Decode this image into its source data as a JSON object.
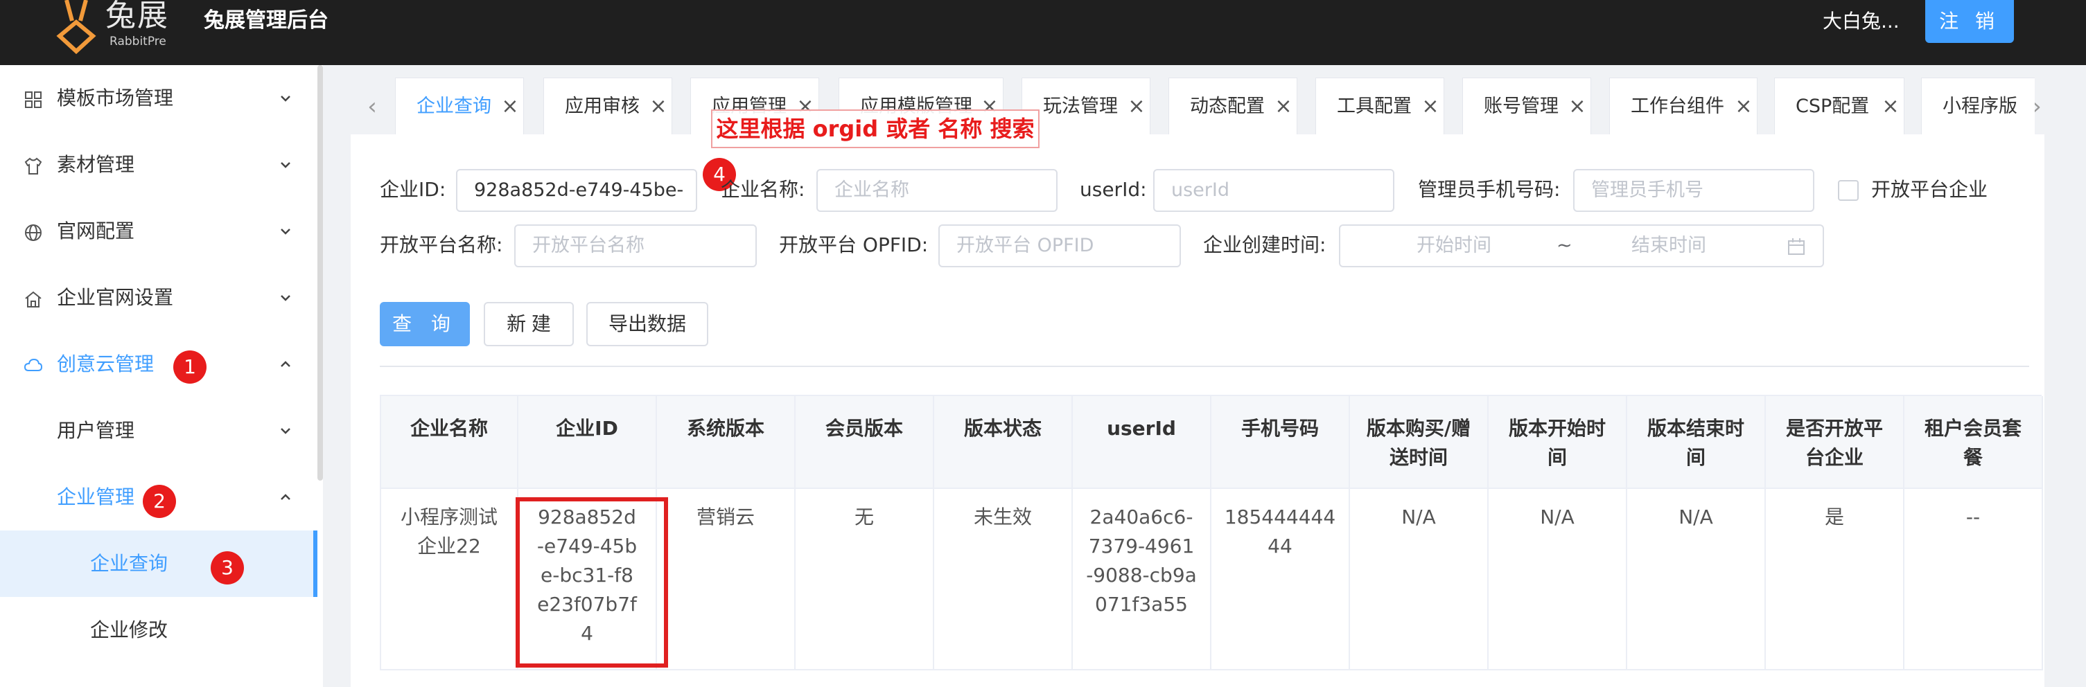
{
  "header": {
    "logo_main": "兔展",
    "logo_sub": "RabbitPre",
    "title": "兔展管理后台",
    "user": "大白兔...",
    "logout": "注 销"
  },
  "sidebar": {
    "items": [
      {
        "label": "模板市场管理",
        "icon": "grid-icon",
        "chevron": "down"
      },
      {
        "label": "素材管理",
        "icon": "shirt-icon",
        "chevron": "down"
      },
      {
        "label": "官网配置",
        "icon": "globe-icon",
        "chevron": "down"
      },
      {
        "label": "企业官网设置",
        "icon": "home-icon",
        "chevron": "down"
      },
      {
        "label": "创意云管理",
        "icon": "cloud-icon",
        "chevron": "up",
        "active": true
      },
      {
        "label": "用户管理",
        "chevron": "down"
      },
      {
        "label": "企业管理",
        "chevron": "up",
        "active": true
      },
      {
        "label": "企业查询",
        "selected": true
      },
      {
        "label": "企业修改"
      }
    ],
    "badges": [
      "1",
      "2",
      "3",
      "4"
    ]
  },
  "tabs": [
    {
      "label": "企业查询",
      "active": true
    },
    {
      "label": "应用审核"
    },
    {
      "label": "应用管理"
    },
    {
      "label": "应用模版管理"
    },
    {
      "label": "玩法管理"
    },
    {
      "label": "动态配置"
    },
    {
      "label": "工具配置"
    },
    {
      "label": "账号管理"
    },
    {
      "label": "工作台组件"
    },
    {
      "label": "CSP配置"
    },
    {
      "label": "小程序版"
    }
  ],
  "annotation": "这里根据 orgid 或者 名称 搜索",
  "form": {
    "org_id_label": "企业ID:",
    "org_id_value": "928a852d-e749-45be-",
    "org_name_label": "企业名称:",
    "org_name_placeholder": "企业名称",
    "userid_label": "userId:",
    "userid_placeholder": "userId",
    "admin_phone_label": "管理员手机号码:",
    "admin_phone_placeholder": "管理员手机号",
    "open_platform_checkbox_label": "开放平台企业",
    "op_name_label": "开放平台名称:",
    "op_name_placeholder": "开放平台名称",
    "op_fid_label": "开放平台 OPFID:",
    "op_fid_placeholder": "开放平台 OPFID",
    "created_label": "企业创建时间:",
    "start_placeholder": "开始时间",
    "range_sep": "~",
    "end_placeholder": "结束时间"
  },
  "buttons": {
    "query": "查 询",
    "create": "新 建",
    "export": "导出数据"
  },
  "table": {
    "headers": [
      "企业名称",
      "企业ID",
      "系统版本",
      "会员版本",
      "版本状态",
      "userId",
      "手机号码",
      "版本购买/赠送时间",
      "版本开始时间",
      "版本结束时间",
      "是否开放平台企业",
      "租户会员套餐"
    ],
    "rows": [
      [
        "小程序测试企业22",
        "928a852d-e749-45be-bc31-f8e23f07b7f4",
        "营销云",
        "无",
        "未生效",
        "2a40a6c6-7379-4961-9088-cb9a071f3a55",
        "18544444444",
        "N/A",
        "N/A",
        "N/A",
        "是",
        "--"
      ]
    ]
  }
}
